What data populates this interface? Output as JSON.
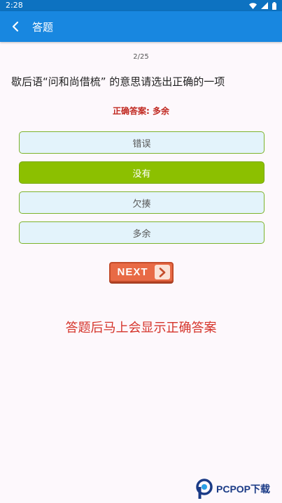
{
  "status_bar": {
    "time": "2:28"
  },
  "app_bar": {
    "title": "答题"
  },
  "quiz": {
    "progress": "2/25",
    "question": "歇后语“问和尚借梳” 的意思请选出正确的一项",
    "answer_label": "正确答案: 多余",
    "options": [
      {
        "label": "错误",
        "selected": false
      },
      {
        "label": "没有",
        "selected": true
      },
      {
        "label": "欠揍",
        "selected": false
      },
      {
        "label": "多余",
        "selected": false
      }
    ],
    "next_label": "NEXT"
  },
  "caption": "答题后马上会显示正确答案",
  "watermark": {
    "text": "PCPOP下载"
  },
  "colors": {
    "status_bar": "#0d72c1",
    "app_bar": "#1887e0",
    "selected_option": "#8cc000",
    "option_bg": "#e3f3fb",
    "answer_text": "#c0271f",
    "next_button": "#e86a45"
  }
}
